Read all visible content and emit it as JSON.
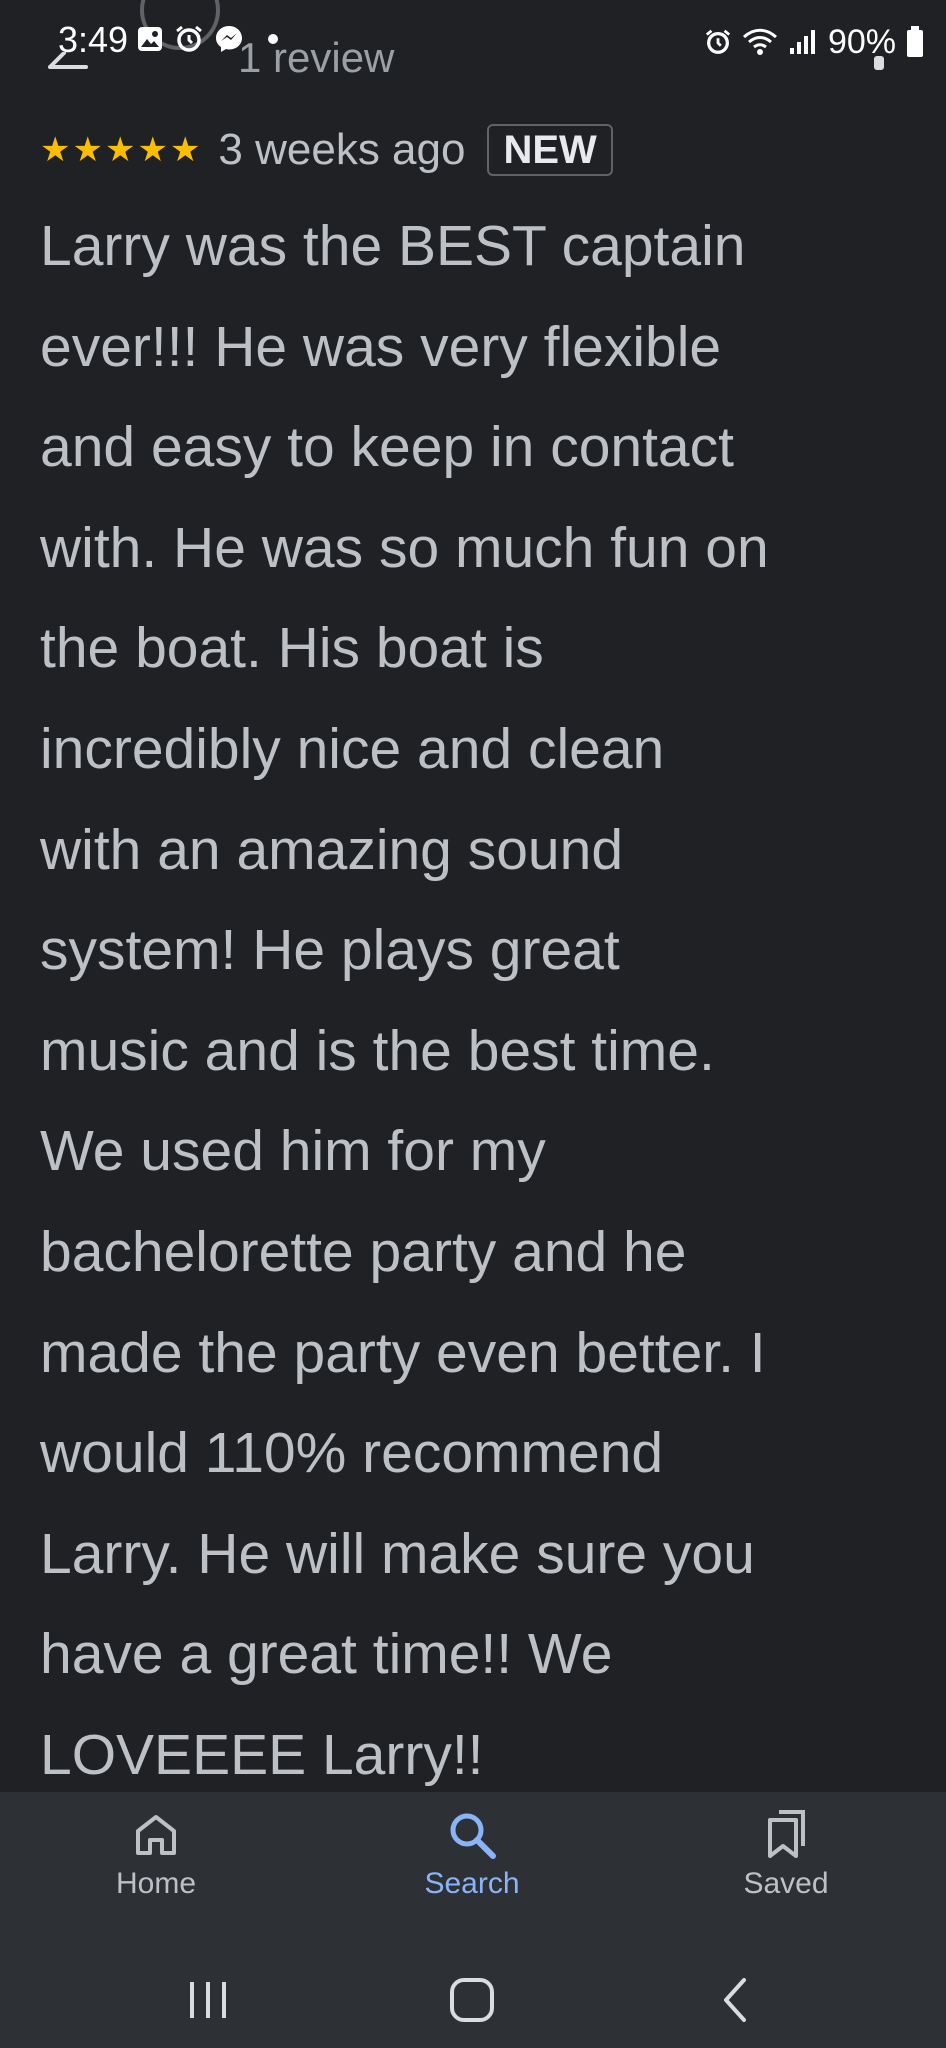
{
  "status_bar": {
    "time": "3:49",
    "battery": "90%",
    "icons": [
      "gallery-icon",
      "alarm-icon",
      "messenger-icon",
      "alarm-icon",
      "wifi-icon",
      "signal-icon",
      "battery-icon"
    ]
  },
  "header": {
    "subtitle": "1 review"
  },
  "review": {
    "rating": 5,
    "stars": [
      "★",
      "★",
      "★",
      "★",
      "★"
    ],
    "date": "3 weeks ago",
    "badge": "NEW",
    "lines": [
      "Larry was the BEST captain",
      "ever!!! He was very flexible",
      "and easy to keep in contact",
      "with. He was so much fun on",
      "the boat. His boat is",
      "incredibly nice and clean",
      "with an amazing sound",
      "system! He plays great",
      "music and is the best time.",
      "We used him for my",
      "bachelorette party and he",
      "made the party even better. I",
      "would 110% recommend",
      "Larry. He will make sure you",
      "have a great time!! We",
      "LOVEEEE Larry!!"
    ]
  },
  "bottom_nav": {
    "items": [
      {
        "label": "Home",
        "icon": "home-icon",
        "active": false
      },
      {
        "label": "Search",
        "icon": "search-icon",
        "active": true
      },
      {
        "label": "Saved",
        "icon": "bookmarks-icon",
        "active": false
      }
    ]
  },
  "colors": {
    "background": "#202124",
    "text": "#bdc1c6",
    "star": "#fbbc04",
    "active_nav": "#8ab4f8",
    "nav_background": "#2d3034"
  }
}
